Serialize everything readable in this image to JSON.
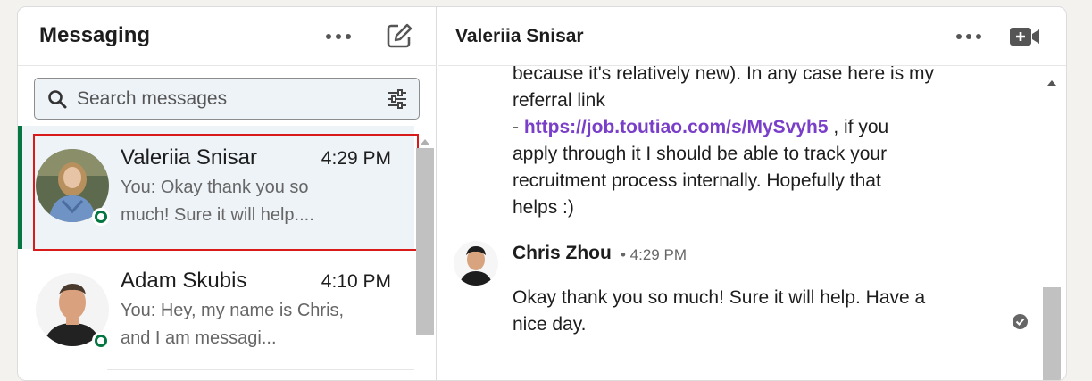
{
  "messaging": {
    "title": "Messaging",
    "search_placeholder": "Search messages"
  },
  "conversations": [
    {
      "name": "Valeriia Snisar",
      "time": "4:29 PM",
      "snippet": "You: Okay thank you so much! Sure it will help...."
    },
    {
      "name": "Adam Skubis",
      "time": "4:10 PM",
      "snippet": "You: Hey, my name is Chris, and I am messagi..."
    }
  ],
  "thread": {
    "title": "Valeriia Snisar",
    "message_line1": "because it's relatively new). In any case here is my",
    "message_line2": "referral link",
    "message_dash": "- ",
    "link": "https://job.toutiao.com/s/MySvyh5",
    "after_link": " , if you",
    "message_line4": "apply through it I should be able to track your",
    "message_line5": "recruitment process internally. Hopefully that",
    "message_line6": "helps :)",
    "reply_sender": "Chris Zhou",
    "reply_time": "• 4:29 PM",
    "reply_line1": "Okay thank you so much! Sure it will help. Have a",
    "reply_line2": "nice day."
  },
  "colors": {
    "online": "#057642",
    "accent": "#057642",
    "link": "#7a3fc9",
    "selection": "#d81a1a"
  }
}
